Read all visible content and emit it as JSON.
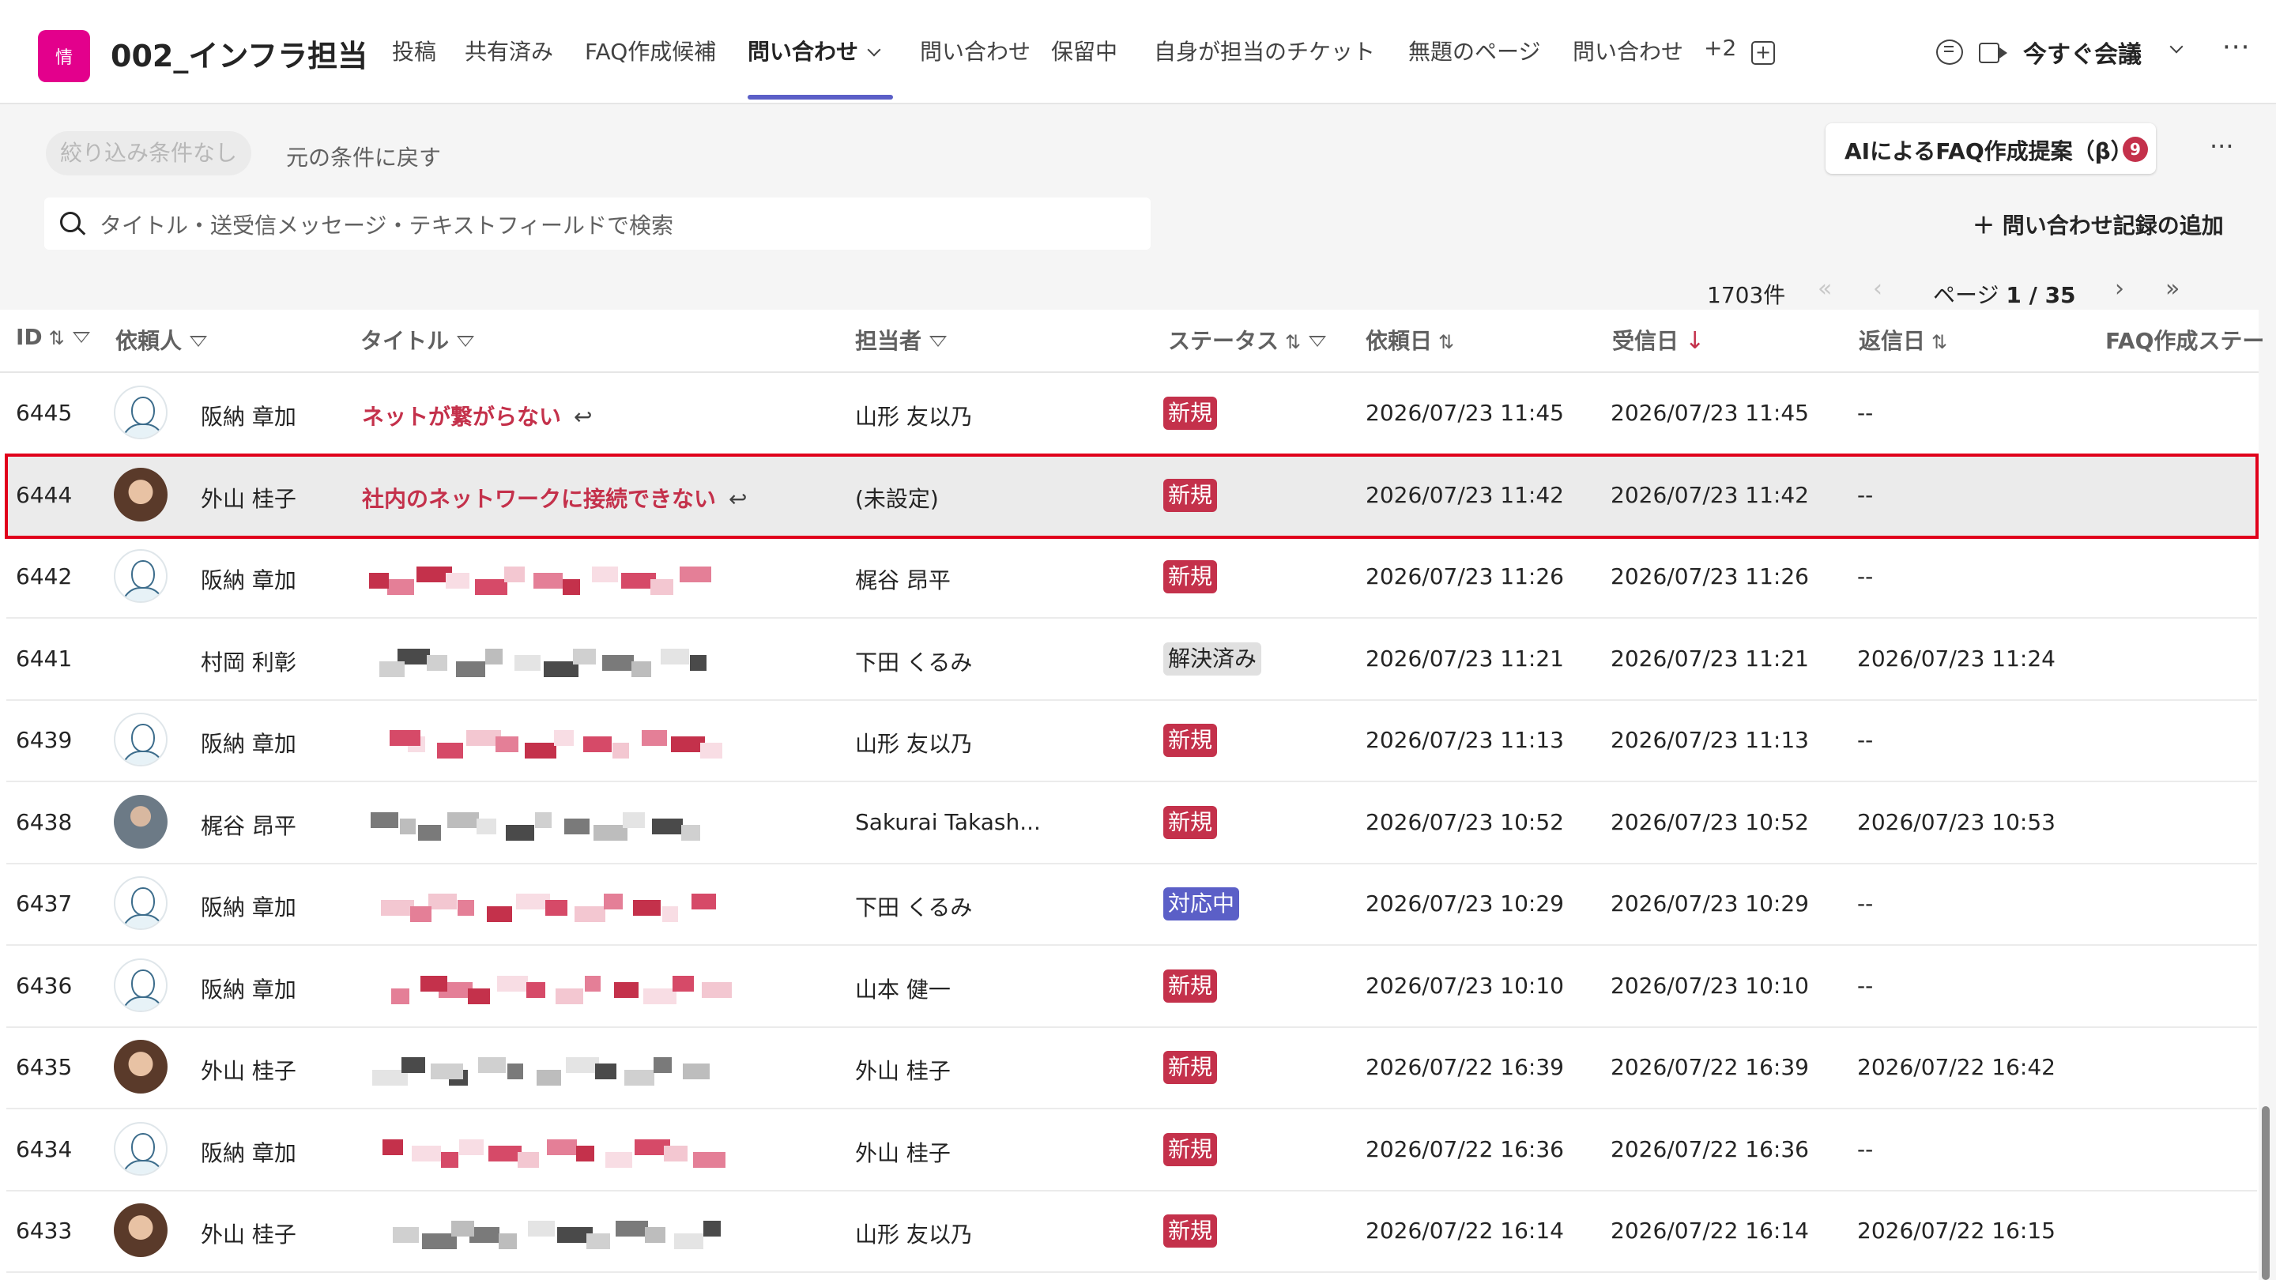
{
  "header": {
    "app_icon_text": "情",
    "channel_name": "002_インフラ担当",
    "tabs": [
      {
        "label": "投稿"
      },
      {
        "label": "共有済み"
      },
      {
        "label": "FAQ作成候補"
      },
      {
        "label": "問い合わせ",
        "active": true
      },
      {
        "label": "問い合わせ"
      },
      {
        "label": "保留中"
      },
      {
        "label": "自身が担当のチケット"
      },
      {
        "label": "無題のページ"
      },
      {
        "label": "問い合わせ"
      },
      {
        "label": "+2"
      }
    ],
    "meet_label": "今すぐ会議",
    "more": "···"
  },
  "toolbar": {
    "filter_none": "絞り込み条件なし",
    "reset": "元の条件に戻す",
    "ai_button": "AIによるFAQ作成提案（β）",
    "ai_badge": "9",
    "more": "···",
    "search_placeholder": "タイトル・送受信メッセージ・テキストフィールドで検索",
    "add_record": "＋ 問い合わせ記録の追加"
  },
  "pagination": {
    "total": "1703件",
    "first": "«",
    "prev": "‹",
    "page_label": "ページ",
    "page_value": "1 / 35",
    "next": "›",
    "last": "»"
  },
  "columns": {
    "id": "ID",
    "requester": "依頼人",
    "title": "タイトル",
    "assignee": "担当者",
    "status": "ステータス",
    "request_date": "依頼日",
    "received_date": "受信日",
    "reply_date": "返信日",
    "faq_status": "FAQ作成ステー"
  },
  "icons": {
    "sort": "⇅",
    "sort_desc": "↓",
    "reply": "↩"
  },
  "colors": {
    "accent": "#5b5fc7",
    "status_new": "#c4314b",
    "status_in_progress": "#5b5fc7",
    "status_resolved": "#e0e0e0",
    "selection_outline": "#e0001b",
    "app_icon": "#e3008c"
  },
  "rows": [
    {
      "id": "6445",
      "requester": "阪納 章加",
      "avatar": "illustration",
      "title": "ネットが繋がらない",
      "title_redacted": false,
      "assignee": "山形 友以乃",
      "status": "新規",
      "status_type": "new",
      "request": "2026/07/23 11:45",
      "received": "2026/07/23 11:45",
      "reply": "--"
    },
    {
      "id": "6444",
      "requester": "外山 桂子",
      "avatar": "photo",
      "title": "社内のネットワークに接続できない",
      "title_redacted": false,
      "assignee": "(未設定)",
      "status": "新規",
      "status_type": "new",
      "request": "2026/07/23 11:42",
      "received": "2026/07/23 11:42",
      "reply": "--",
      "selected": true
    },
    {
      "id": "6442",
      "requester": "阪納 章加",
      "avatar": "illustration",
      "title_redacted": true,
      "redact": "red",
      "assignee": "梶谷 昂平",
      "status": "新規",
      "status_type": "new",
      "request": "2026/07/23 11:26",
      "received": "2026/07/23 11:26",
      "reply": "--"
    },
    {
      "id": "6441",
      "requester": "村岡 利彰",
      "avatar": "none",
      "title_redacted": true,
      "redact": "gray",
      "assignee": "下田 くるみ",
      "status": "解決済み",
      "status_type": "done",
      "request": "2026/07/23 11:21",
      "received": "2026/07/23 11:21",
      "reply": "2026/07/23 11:24"
    },
    {
      "id": "6439",
      "requester": "阪納 章加",
      "avatar": "illustration",
      "title_redacted": true,
      "redact": "red",
      "assignee": "山形 友以乃",
      "status": "新規",
      "status_type": "new",
      "request": "2026/07/23 11:13",
      "received": "2026/07/23 11:13",
      "reply": "--"
    },
    {
      "id": "6438",
      "requester": "梶谷 昂平",
      "avatar": "man",
      "title_redacted": true,
      "redact": "gray",
      "assignee": "Sakurai Takash...",
      "status": "新規",
      "status_type": "new",
      "request": "2026/07/23 10:52",
      "received": "2026/07/23 10:52",
      "reply": "2026/07/23 10:53"
    },
    {
      "id": "6437",
      "requester": "阪納 章加",
      "avatar": "illustration",
      "title_redacted": true,
      "redact": "red",
      "assignee": "下田 くるみ",
      "status": "対応中",
      "status_type": "prog",
      "request": "2026/07/23 10:29",
      "received": "2026/07/23 10:29",
      "reply": "--"
    },
    {
      "id": "6436",
      "requester": "阪納 章加",
      "avatar": "illustration",
      "title_redacted": true,
      "redact": "red",
      "assignee": "山本 健一",
      "status": "新規",
      "status_type": "new",
      "request": "2026/07/23 10:10",
      "received": "2026/07/23 10:10",
      "reply": "--"
    },
    {
      "id": "6435",
      "requester": "外山 桂子",
      "avatar": "photo",
      "title_redacted": true,
      "redact": "gray",
      "assignee": "外山 桂子",
      "status": "新規",
      "status_type": "new",
      "request": "2026/07/22 16:39",
      "received": "2026/07/22 16:39",
      "reply": "2026/07/22 16:42"
    },
    {
      "id": "6434",
      "requester": "阪納 章加",
      "avatar": "illustration",
      "title_redacted": true,
      "redact": "red",
      "assignee": "外山 桂子",
      "status": "新規",
      "status_type": "new",
      "request": "2026/07/22 16:36",
      "received": "2026/07/22 16:36",
      "reply": "--"
    },
    {
      "id": "6433",
      "requester": "外山 桂子",
      "avatar": "photo",
      "title_redacted": true,
      "redact": "gray",
      "assignee": "山形 友以乃",
      "status": "新規",
      "status_type": "new",
      "request": "2026/07/22 16:14",
      "received": "2026/07/22 16:14",
      "reply": "2026/07/22 16:15"
    }
  ]
}
